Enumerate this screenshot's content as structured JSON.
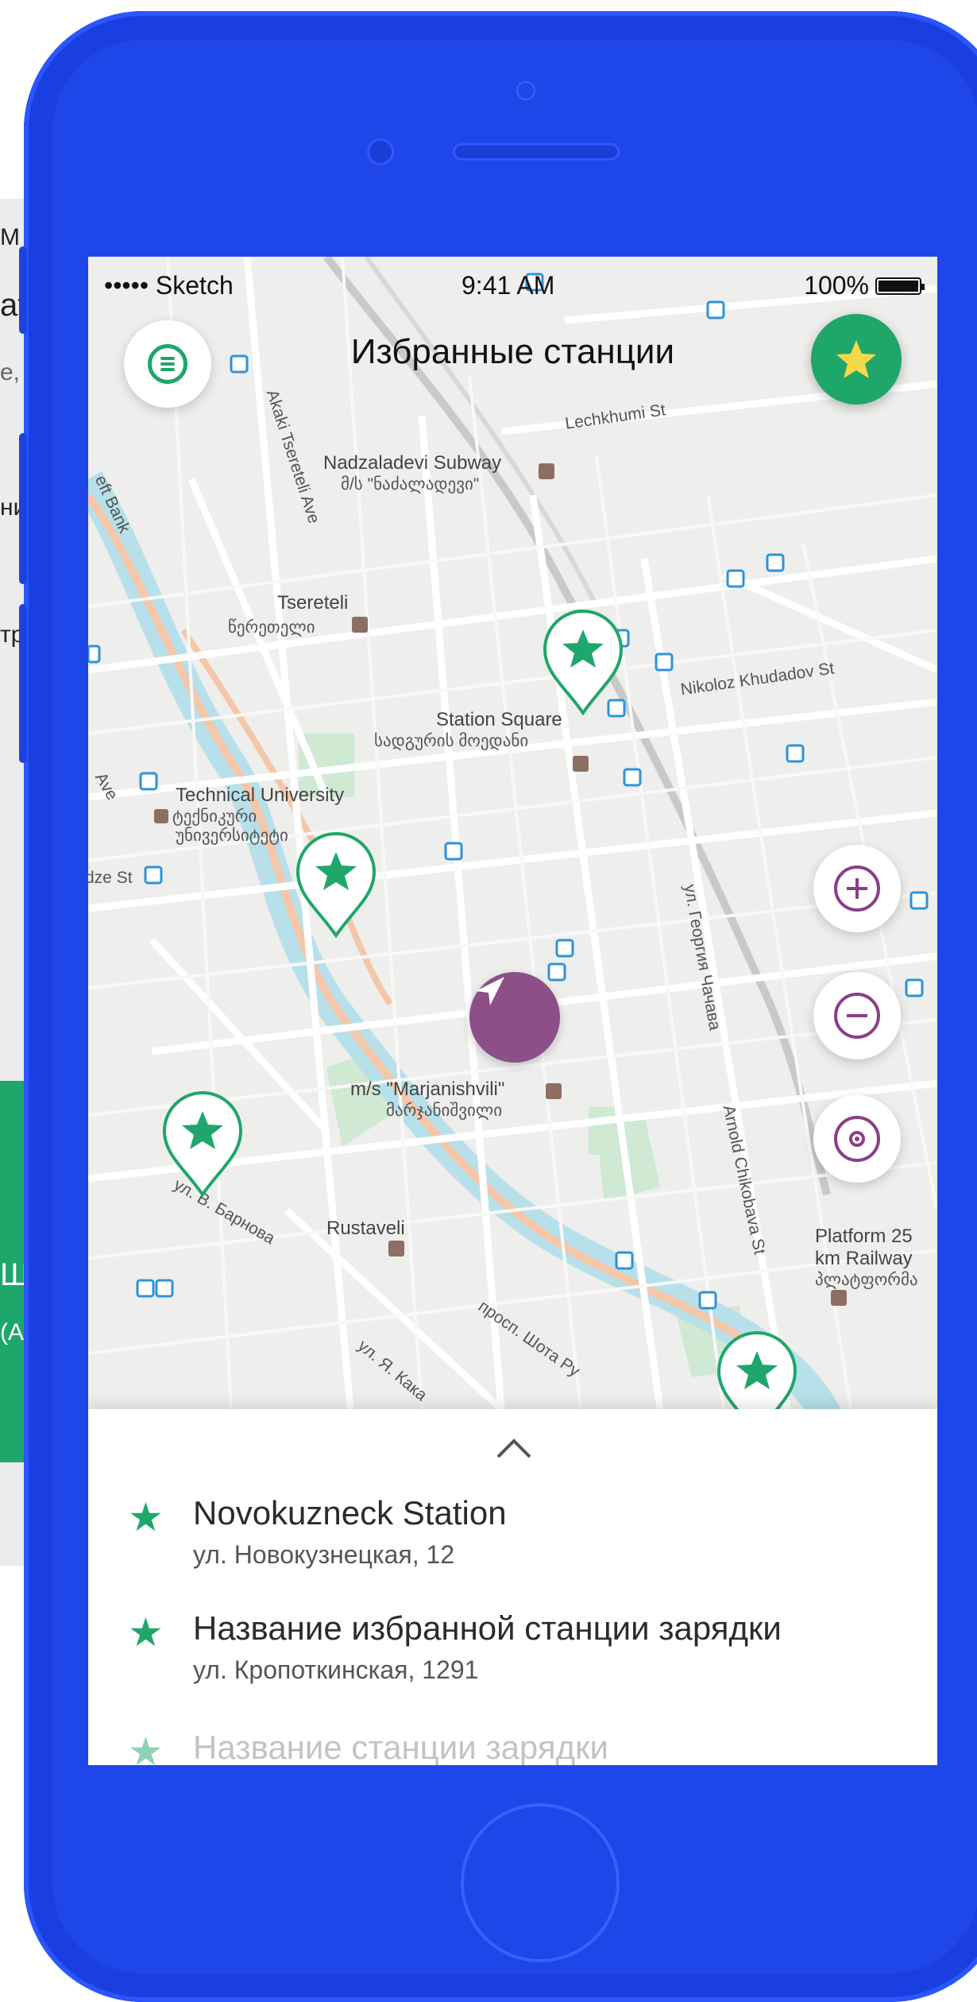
{
  "status_bar": {
    "carrier": "••••• Sketch",
    "time": "9:41 AM",
    "battery": "100%"
  },
  "header": {
    "title": "Избранные станции"
  },
  "background_fragments": {
    "t1": "M",
    "t2": "at",
    "t3": "e, /",
    "t4": "ни",
    "t5": "тр",
    "t6": "Ш",
    "t7": "(А"
  },
  "map_labels": {
    "nadzaladevi": "Nadzaladevi Subway",
    "nadzaladevi_geo": "მ/ს \"ნაძალადევი\"",
    "tsereteli": "Tsereteli",
    "tsereteli_geo": "წერეთელი",
    "station_square": "Station Square",
    "station_square_geo": "სადგურის მოედანი",
    "technical_university": "Technical University",
    "technical_university_geo": "ტექნიკური",
    "technical_university_geo2": "უნივერსიტეტი",
    "marjanishvili": "m/s \"Marjanishvili\"",
    "marjanishvili_geo": "მარჯანიშვილი",
    "rustaveli": "Rustaveli",
    "platform": "Platform 25",
    "platform2": "km Railway",
    "platform_geo": "პლატფორმა",
    "lechkhumi": "Lechkhumi St",
    "kholoz": "Nikoloz Khudadov St",
    "chavchavadze": "ул. Георгия Чачава",
    "chikobava": "Arnold Chikobava St",
    "barnova": "ул. В. Барнова",
    "shota": "просп. Шота Ру",
    "kaka": "ул. Я. Кака",
    "left_bank": "eft Bank",
    "zestafoni": "dze St",
    "ave": "Ave",
    "tsereteli_ave": "Akaki Tsereteli Ave"
  },
  "icons": {
    "menu": "menu-icon",
    "favorites": "star-icon",
    "zoom_in": "plus-icon",
    "zoom_out": "minus-icon",
    "locate": "target-icon",
    "navigation": "navigation-arrow-icon",
    "expand": "chevron-up-icon"
  },
  "colors": {
    "phone": "#1e46e8",
    "accent_green": "#1fa66b",
    "accent_purple": "#8a3f88",
    "star_yellow": "#f6d94a"
  },
  "stations": [
    {
      "name": "Novokuzneck Station",
      "address": "ул. Новокузнецкая, 12"
    },
    {
      "name": "Название избранной станции зарядки",
      "address": "ул. Кропоткинская, 1291"
    },
    {
      "name": "Название станции зарядки",
      "address": ""
    }
  ]
}
